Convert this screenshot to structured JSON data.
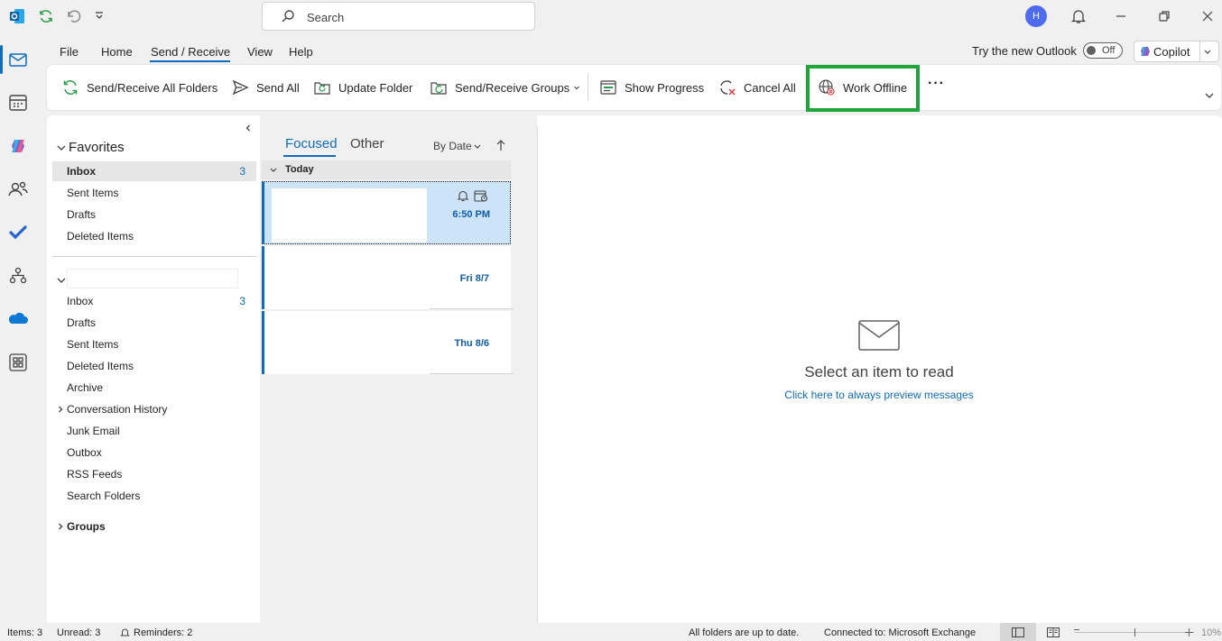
{
  "titlebar": {
    "search_placeholder": "Search",
    "avatar_initial": "H"
  },
  "menu": {
    "tabs": [
      "File",
      "Home",
      "Send / Receive",
      "View",
      "Help"
    ],
    "active_tab": "Send / Receive",
    "try_new_outlook": "Try the new Outlook",
    "toggle_state": "Off",
    "copilot": "Copilot"
  },
  "ribbon": {
    "send_receive_all": "Send/Receive All Folders",
    "send_all": "Send All",
    "update_folder": "Update Folder",
    "send_receive_groups": "Send/Receive Groups",
    "show_progress": "Show Progress",
    "cancel_all": "Cancel All",
    "work_offline": "Work Offline",
    "more": "···"
  },
  "favorites": {
    "header": "Favorites",
    "items": [
      {
        "label": "Inbox",
        "count": "3"
      },
      {
        "label": "Sent Items",
        "count": ""
      },
      {
        "label": "Drafts",
        "count": ""
      },
      {
        "label": "Deleted Items",
        "count": ""
      }
    ]
  },
  "mailbox": {
    "items": [
      {
        "label": "Inbox",
        "count": "3"
      },
      {
        "label": "Drafts",
        "count": ""
      },
      {
        "label": "Sent Items",
        "count": ""
      },
      {
        "label": "Deleted Items",
        "count": ""
      },
      {
        "label": "Archive",
        "count": ""
      },
      {
        "label": "Conversation History",
        "count": ""
      },
      {
        "label": "Junk Email",
        "count": ""
      },
      {
        "label": "Outbox",
        "count": ""
      },
      {
        "label": "RSS Feeds",
        "count": ""
      },
      {
        "label": "Search Folders",
        "count": ""
      }
    ],
    "groups": "Groups"
  },
  "message_list": {
    "tab_focused": "Focused",
    "tab_other": "Other",
    "sort": "By Date",
    "group_header": "Today",
    "items": [
      {
        "time": "6:50 PM"
      },
      {
        "time": "Fri 8/7"
      },
      {
        "time": "Thu 8/6"
      }
    ]
  },
  "reading_pane": {
    "title": "Select an item to read",
    "link": "Click here to always preview messages"
  },
  "statusbar": {
    "items": "Items: 3",
    "unread": "Unread: 3",
    "reminders": "Reminders: 2",
    "sync_status": "All folders are up to date.",
    "connection": "Connected to: Microsoft Exchange",
    "zoom": "10%"
  },
  "colors": {
    "accent": "#0f6cbd",
    "highlight_box": "#1ea63a",
    "selected_item": "#cde3f7"
  }
}
